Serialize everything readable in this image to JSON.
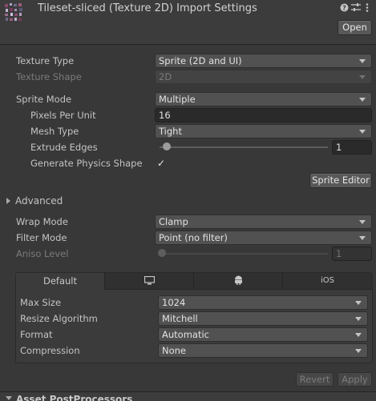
{
  "header": {
    "title": "Tileset-sliced (Texture 2D) Import Settings",
    "open_label": "Open",
    "help_icon": "help-icon",
    "settings_icon": "sliders-icon",
    "menu_icon": "kebab-menu-icon"
  },
  "settings": {
    "texture_type": {
      "label": "Texture Type",
      "value": "Sprite (2D and UI)"
    },
    "texture_shape": {
      "label": "Texture Shape",
      "value": "2D"
    },
    "sprite_mode": {
      "label": "Sprite Mode",
      "value": "Multiple"
    },
    "pixels_per_unit": {
      "label": "Pixels Per Unit",
      "value": "16"
    },
    "mesh_type": {
      "label": "Mesh Type",
      "value": "Tight"
    },
    "extrude_edges": {
      "label": "Extrude Edges",
      "value": "1",
      "slider_fraction": 0.03
    },
    "generate_physics_shape": {
      "label": "Generate Physics Shape",
      "checked": true,
      "check_glyph": "✓"
    },
    "sprite_editor_label": "Sprite Editor"
  },
  "advanced": {
    "label": "Advanced",
    "expanded": false
  },
  "sampling": {
    "wrap_mode": {
      "label": "Wrap Mode",
      "value": "Clamp"
    },
    "filter_mode": {
      "label": "Filter Mode",
      "value": "Point (no filter)"
    },
    "aniso_level": {
      "label": "Aniso Level",
      "value": "1",
      "slider_fraction": 0.0
    }
  },
  "platform": {
    "tabs": [
      {
        "label": "Default",
        "icon": ""
      },
      {
        "label": "",
        "icon": "monitor-icon"
      },
      {
        "label": "",
        "icon": "android-icon"
      },
      {
        "label": "iOS",
        "icon": ""
      }
    ],
    "max_size": {
      "label": "Max Size",
      "value": "1024"
    },
    "resize_algorithm": {
      "label": "Resize Algorithm",
      "value": "Mitchell"
    },
    "format": {
      "label": "Format",
      "value": "Automatic"
    },
    "compression": {
      "label": "Compression",
      "value": "None"
    }
  },
  "footer": {
    "revert_label": "Revert",
    "apply_label": "Apply",
    "next_section_label": "Asset PostProcessors"
  }
}
